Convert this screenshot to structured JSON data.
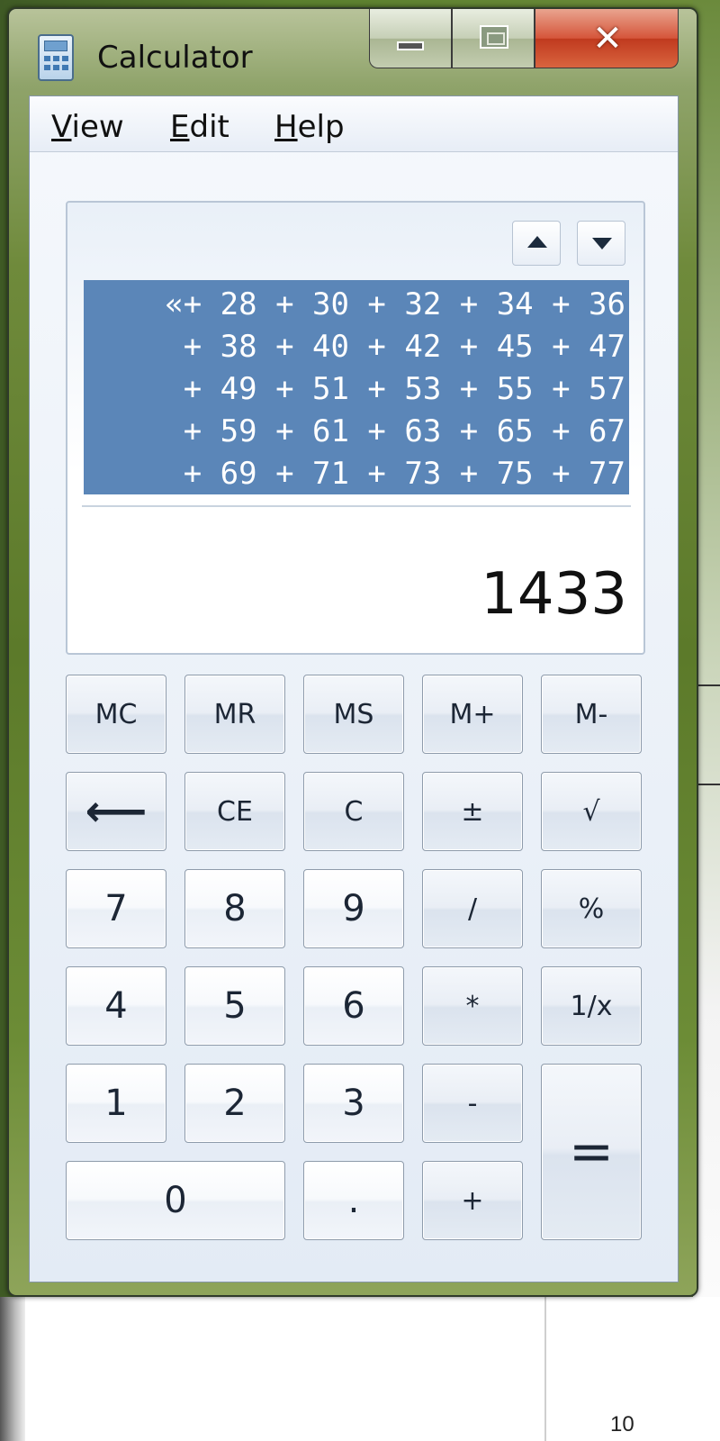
{
  "window": {
    "title": "Calculator",
    "icon": "calculator-icon",
    "controls": {
      "minimize": "minimize-icon",
      "maximize": "maximize-icon",
      "close": "✕"
    }
  },
  "menu": [
    {
      "accel": "V",
      "rest": "iew"
    },
    {
      "accel": "E",
      "rest": "dit"
    },
    {
      "accel": "H",
      "rest": "elp"
    }
  ],
  "display": {
    "history_lines": [
      "«+ 28 + 30 + 32 + 34 + 36",
      " + 38 + 40 + 42 + 45 + 47",
      " + 49 + 51 + 53 + 55 + 57",
      " + 59 + 61 + 63 + 65 + 67",
      " + 69 + 71 + 73 + 75 + 77"
    ],
    "result": "1433"
  },
  "keys": {
    "mc": "MC",
    "mr": "MR",
    "ms": "MS",
    "mplus": "M+",
    "mminus": "M-",
    "back": "⟵",
    "ce": "CE",
    "c": "C",
    "plusminus": "±",
    "sqrt": "√",
    "k7": "7",
    "k8": "8",
    "k9": "9",
    "div": "/",
    "pct": "%",
    "k4": "4",
    "k5": "5",
    "k6": "6",
    "mul": "*",
    "recip": "1/x",
    "k1": "1",
    "k2": "2",
    "k3": "3",
    "sub": "-",
    "eq": "=",
    "k0": "0",
    "dot": ".",
    "add": "+"
  },
  "background": {
    "fragment": "10"
  },
  "colors": {
    "history_highlight": "#5b86b8",
    "close_button": "#c03a1e"
  }
}
